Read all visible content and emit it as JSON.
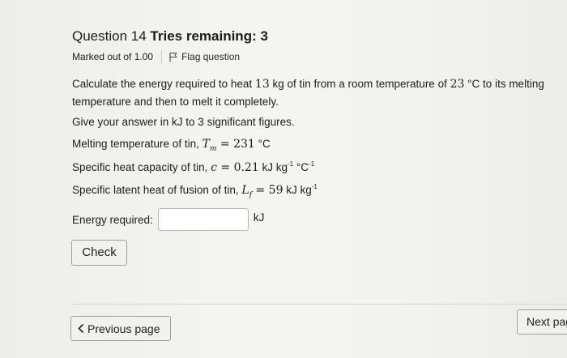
{
  "question": {
    "number_label": "Question 14",
    "tries_label": "Tries remaining: 3",
    "marked_out_of": "Marked out of 1.00",
    "flag_label": "Flag question",
    "text_part1": "Calculate the energy required to heat ",
    "mass": "13",
    "text_part2": " kg of tin from a room temperature of ",
    "room_temp": "23",
    "text_part3": " °C to its melting temperature and then to melt it completely.",
    "instruction": "Give your answer in kJ to 3 significant figures.",
    "melting": {
      "label": "Melting temperature of tin, ",
      "symbol": "T",
      "subscript": "m",
      "equals": " = ",
      "value": "231",
      "unit": " °C"
    },
    "heat_capacity": {
      "label": "Specific heat capacity of tin, ",
      "symbol": "c",
      "equals": " = ",
      "value": "0.21",
      "unit_kj": " kJ kg",
      "sup1": "-1",
      "unit_c": " °C",
      "sup2": "-1"
    },
    "latent_heat": {
      "label": "Specific latent heat of fusion of tin, ",
      "symbol": "L",
      "subscript": "f",
      "equals": " = ",
      "value": "59",
      "unit": " kJ kg",
      "sup": "-1"
    }
  },
  "answer": {
    "label": "Energy required:",
    "value": "",
    "placeholder": "",
    "unit": "kJ"
  },
  "buttons": {
    "check": "Check",
    "previous": "Previous page",
    "next": "Next pag"
  },
  "icons": {
    "flag": "flag-icon",
    "previous": "chevron-left-icon"
  }
}
